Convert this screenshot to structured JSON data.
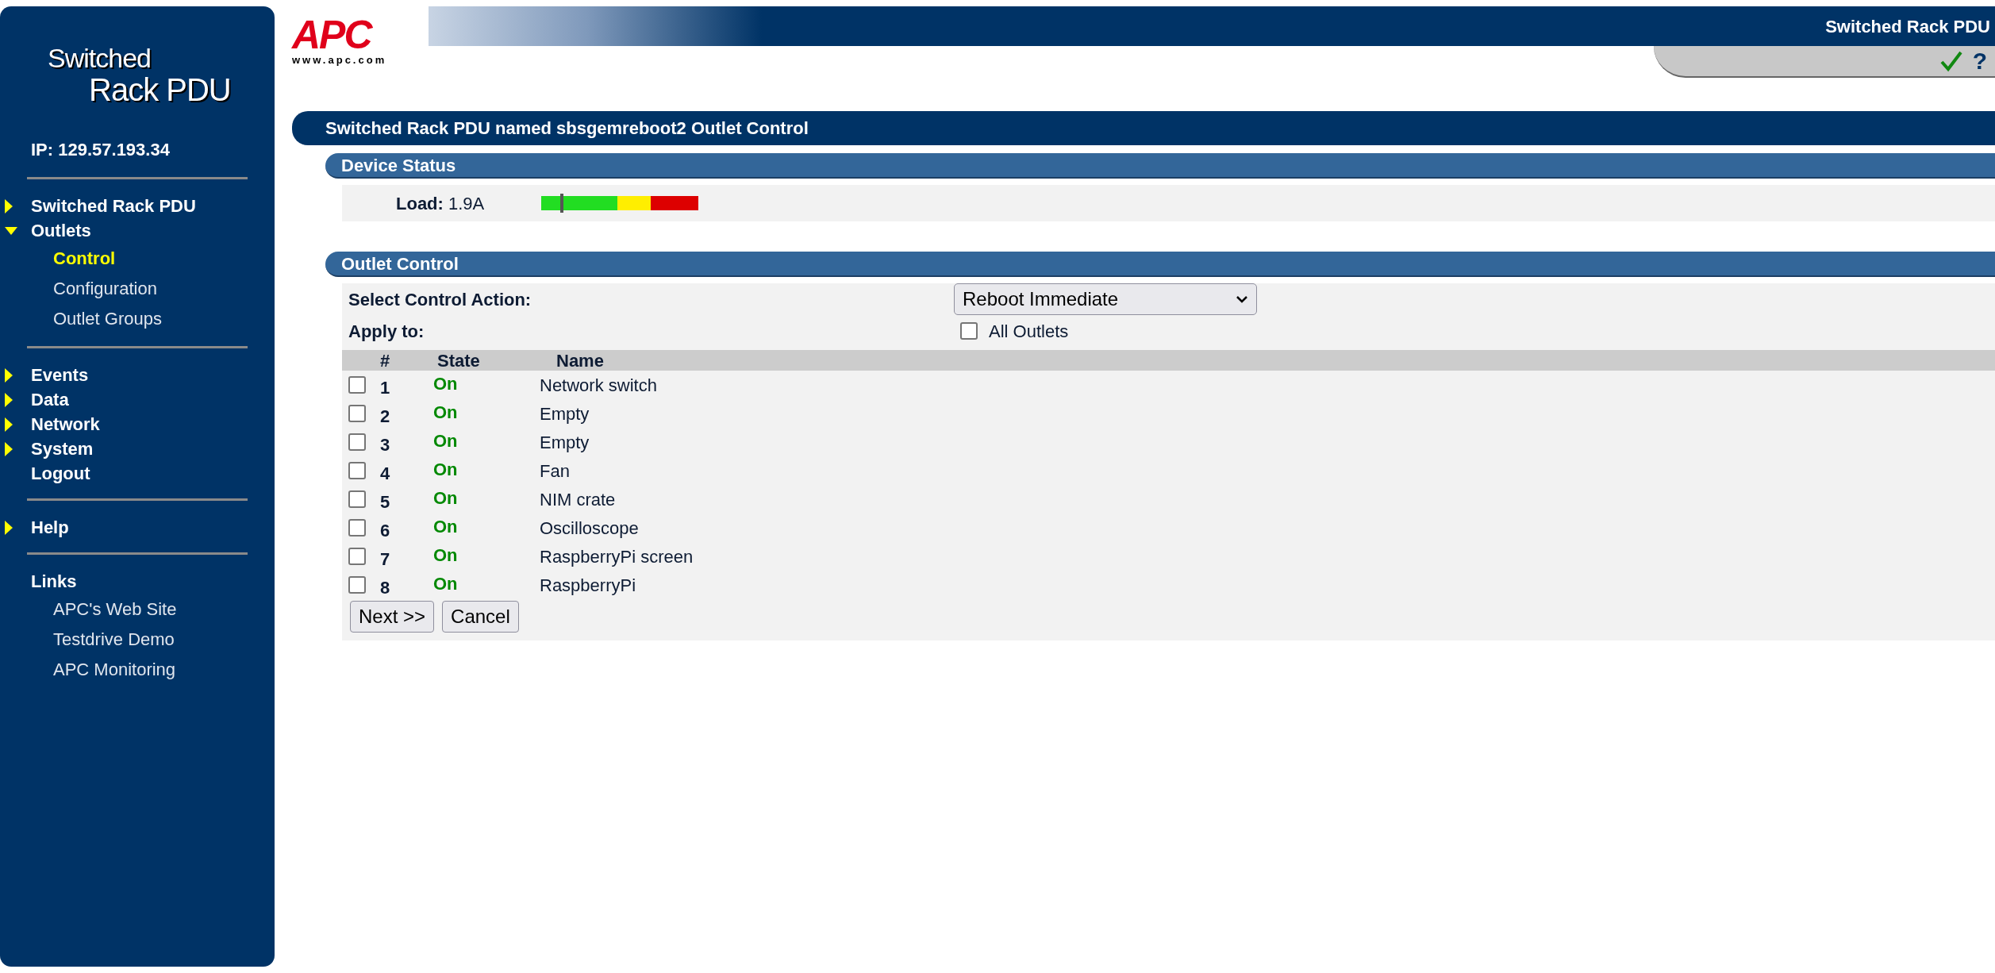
{
  "sidebar": {
    "logo_lines": [
      "Switched",
      "Rack PDU"
    ],
    "ip": "IP: 129.57.193.34",
    "groups": [
      {
        "items": [
          {
            "label": "Switched Rack PDU",
            "kind": "menu",
            "expanded": false
          },
          {
            "label": "Outlets",
            "kind": "menu",
            "expanded": true,
            "children": [
              {
                "label": "Control",
                "selected": true
              },
              {
                "label": "Configuration",
                "selected": false
              },
              {
                "label": "Outlet Groups",
                "selected": false
              }
            ]
          }
        ]
      },
      {
        "items": [
          {
            "label": "Events",
            "kind": "menu",
            "expanded": false
          },
          {
            "label": "Data",
            "kind": "menu",
            "expanded": false
          },
          {
            "label": "Network",
            "kind": "menu",
            "expanded": false
          },
          {
            "label": "System",
            "kind": "menu",
            "expanded": false
          },
          {
            "label": "Logout",
            "kind": "plain"
          }
        ]
      },
      {
        "items": [
          {
            "label": "Help",
            "kind": "menu",
            "expanded": false
          }
        ]
      },
      {
        "items": [
          {
            "label": "Links",
            "kind": "heading",
            "children": [
              {
                "label": "APC's Web Site",
                "selected": false
              },
              {
                "label": "Testdrive Demo",
                "selected": false
              },
              {
                "label": "APC Monitoring",
                "selected": false
              }
            ]
          }
        ]
      }
    ]
  },
  "header": {
    "logo": "APC",
    "logo_url": "www.apc.com",
    "product": "Switched Rack PDU",
    "help": "?"
  },
  "page_title": "Switched Rack PDU named sbsgemreboot2 Outlet Control",
  "device_status": {
    "title": "Device Status",
    "load_label": "Load:",
    "load_value": "1.9A",
    "level": 0.12
  },
  "outlet_control": {
    "title": "Outlet Control",
    "action_label": "Select Control Action:",
    "action_value": "Reboot Immediate",
    "apply_label": "Apply to:",
    "all_outlets": {
      "label": "All Outlets",
      "checked": false
    },
    "columns": [
      "#",
      "State",
      "Name"
    ],
    "rows": [
      {
        "number": "1",
        "state": "On",
        "name": "Network switch",
        "checked": false
      },
      {
        "number": "2",
        "state": "On",
        "name": "Empty",
        "checked": false
      },
      {
        "number": "3",
        "state": "On",
        "name": "Empty",
        "checked": false
      },
      {
        "number": "4",
        "state": "On",
        "name": "Fan",
        "checked": false
      },
      {
        "number": "5",
        "state": "On",
        "name": "NIM crate",
        "checked": false
      },
      {
        "number": "6",
        "state": "On",
        "name": "Oscilloscope",
        "checked": false
      },
      {
        "number": "7",
        "state": "On",
        "name": "RaspberryPi screen",
        "checked": false
      },
      {
        "number": "8",
        "state": "On",
        "name": "RaspberryPi",
        "checked": false
      }
    ],
    "buttons": [
      "Next >>",
      "Cancel"
    ]
  }
}
